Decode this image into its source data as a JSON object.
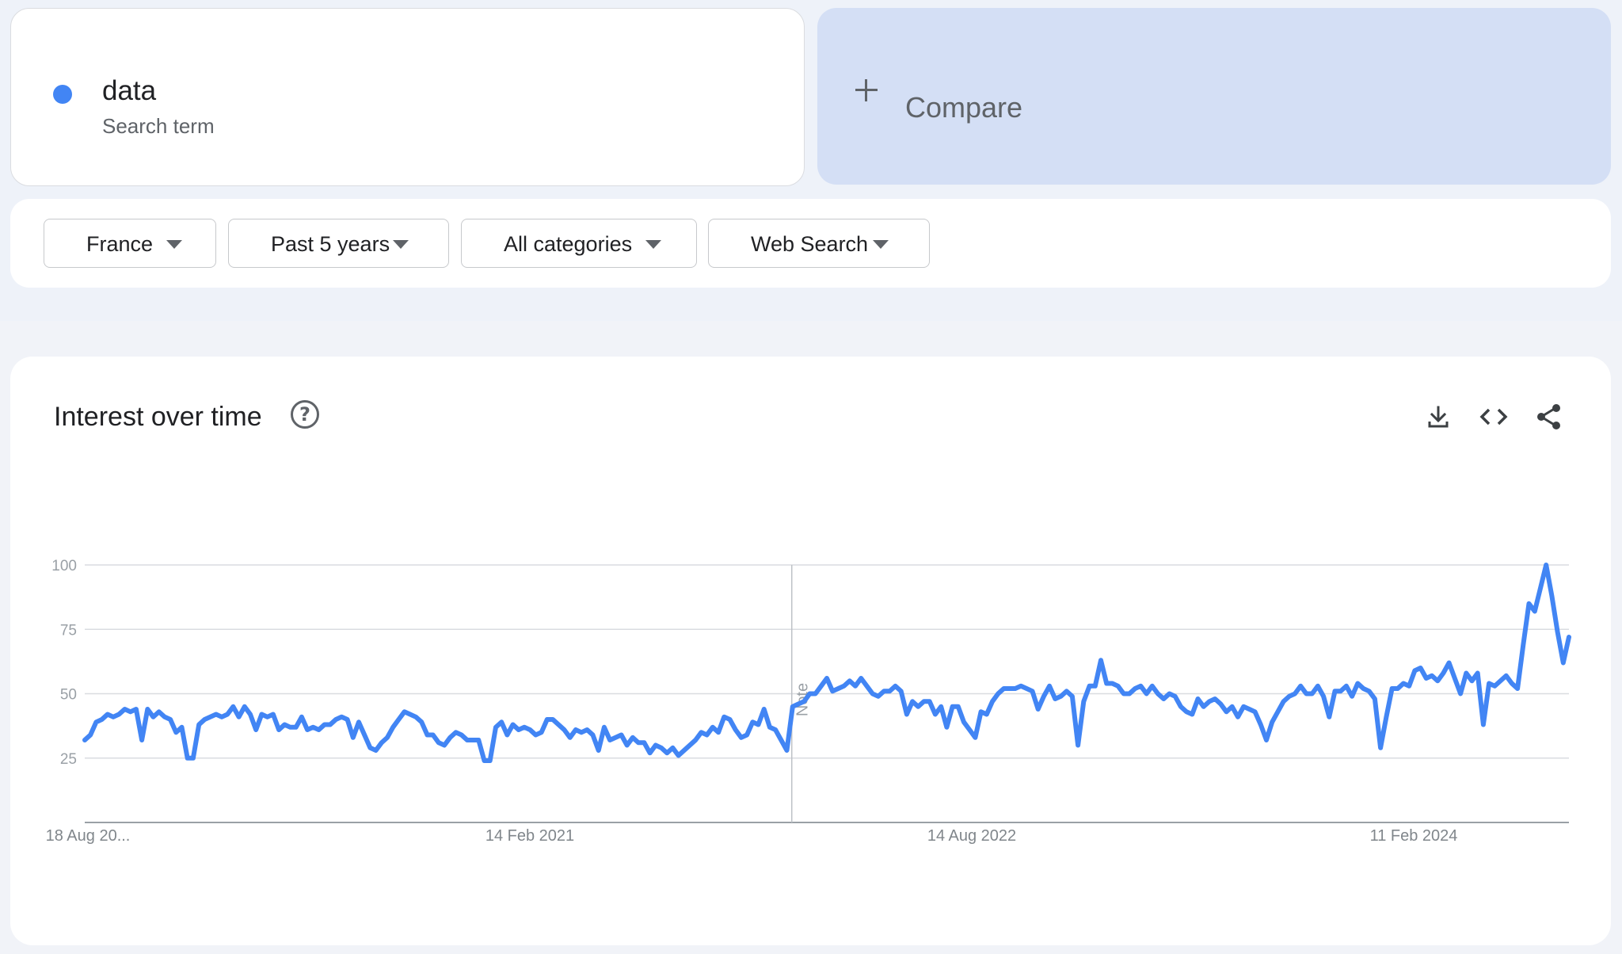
{
  "search_term": {
    "name": "data",
    "subtitle": "Search term",
    "color": "#4285f4"
  },
  "compare": {
    "label": "Compare",
    "icon": "plus-icon"
  },
  "filters": [
    {
      "label": "France",
      "icon": "caret-down-icon"
    },
    {
      "label": "Past 5 years",
      "icon": "caret-down-icon"
    },
    {
      "label": "All categories",
      "icon": "caret-down-icon"
    },
    {
      "label": "Web Search",
      "icon": "caret-down-icon"
    }
  ],
  "interest_card": {
    "title": "Interest over time",
    "help_icon": "help-icon",
    "help_glyph": "?",
    "actions": [
      "download-icon",
      "embed-code-icon",
      "share-icon"
    ]
  },
  "chart_data": {
    "type": "line",
    "title": "",
    "xlabel": "",
    "ylabel": "",
    "ylim": [
      0,
      100
    ],
    "yticks": [
      25,
      50,
      75,
      100
    ],
    "grid": true,
    "x_tick_labels": [
      "18 Aug 20...",
      "14 Feb 2021",
      "14 Aug 2022",
      "11 Feb 2024"
    ],
    "x_range": [
      "2019-08-18",
      "2024-08-11"
    ],
    "annotation": {
      "label": "Note",
      "date": "2022-01-01"
    },
    "series": [
      {
        "color": "#4285f4",
        "values": [
          32,
          34,
          39,
          40,
          42,
          41,
          42,
          44,
          43,
          44,
          32,
          44,
          41,
          43,
          41,
          40,
          35,
          37,
          25,
          25,
          38,
          40,
          41,
          42,
          41,
          42,
          45,
          41,
          45,
          42,
          36,
          42,
          41,
          42,
          36,
          38,
          37,
          37,
          41,
          36,
          37,
          36,
          38,
          38,
          40,
          41,
          40,
          33,
          39,
          34,
          29,
          28,
          31,
          33,
          37,
          40,
          43,
          42,
          41,
          39,
          34,
          34,
          31,
          30,
          33,
          35,
          34,
          32,
          32,
          32,
          24,
          24,
          37,
          39,
          34,
          38,
          36,
          37,
          36,
          34,
          35,
          40,
          40,
          38,
          36,
          33,
          36,
          35,
          36,
          34,
          28,
          37,
          32,
          33,
          34,
          30,
          33,
          31,
          31,
          27,
          30,
          29,
          27,
          29,
          26,
          28,
          30,
          32,
          35,
          34,
          37,
          35,
          41,
          40,
          36,
          33,
          34,
          39,
          38,
          44,
          37,
          36,
          32,
          28,
          45,
          46,
          47,
          50,
          50,
          53,
          56,
          51,
          52,
          53,
          55,
          53,
          56,
          53,
          50,
          49,
          51,
          51,
          53,
          51,
          42,
          47,
          45,
          47,
          47,
          42,
          45,
          37,
          45,
          45,
          39,
          36,
          33,
          43,
          42,
          47,
          50,
          52,
          52,
          52,
          53,
          52,
          51,
          44,
          49,
          53,
          48,
          49,
          51,
          49,
          30,
          47,
          53,
          53,
          63,
          54,
          54,
          53,
          50,
          50,
          52,
          53,
          50,
          53,
          50,
          48,
          50,
          49,
          45,
          43,
          42,
          48,
          45,
          47,
          48,
          46,
          43,
          45,
          41,
          45,
          44,
          43,
          38,
          32,
          39,
          43,
          47,
          49,
          50,
          53,
          50,
          50,
          53,
          49,
          41,
          51,
          51,
          53,
          49,
          54,
          52,
          51,
          48,
          29,
          41,
          52,
          52,
          54,
          53,
          59,
          60,
          56,
          57,
          55,
          58,
          62,
          56,
          50,
          58,
          55,
          58,
          38,
          54,
          53,
          55,
          57,
          54,
          52,
          69,
          85,
          82,
          91,
          100,
          88,
          74,
          62,
          72
        ]
      }
    ]
  }
}
